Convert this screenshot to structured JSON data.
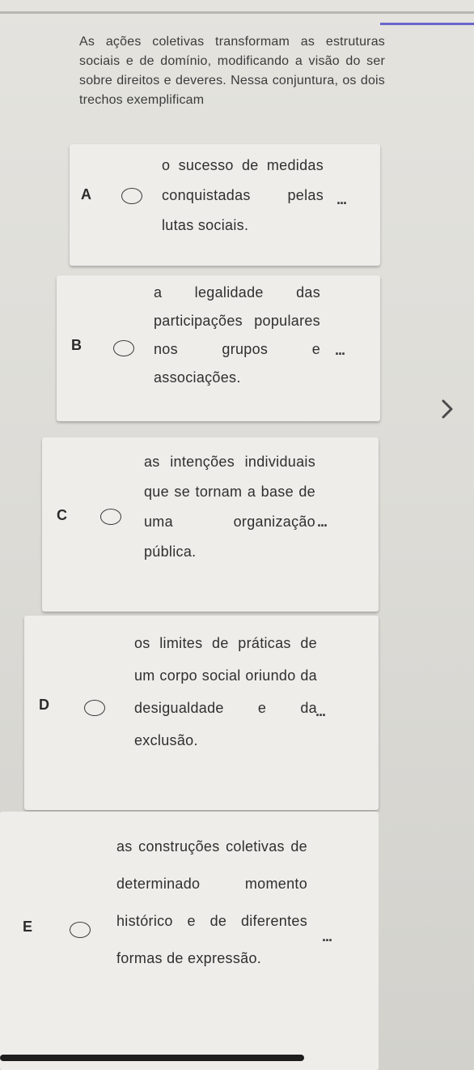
{
  "question": {
    "text": "As ações coletivas transformam as estruturas sociais e de domínio, modificando a visão do ser sobre direitos e deveres. Nessa conjuntura, os dois trechos exemplificam"
  },
  "options": [
    {
      "letter": "A",
      "text": "o sucesso de medidas conquistadas pelas lutas sociais.",
      "more": "..."
    },
    {
      "letter": "B",
      "text": "a legalidade das participações populares nos grupos e associações.",
      "more": "..."
    },
    {
      "letter": "C",
      "text": "as intenções individuais que se tornam a base de uma organização pública.",
      "more": "..."
    },
    {
      "letter": "D",
      "text": "os limites de práticas de um corpo social oriundo da desigualdade e da exclusão.",
      "more": "..."
    },
    {
      "letter": "E",
      "text": "as construções coletivas de determinado momento histórico e de diferentes formas de expressão.",
      "more": "..."
    }
  ],
  "icons": {
    "next": "chevron-right-icon",
    "more": "ellipsis-icon",
    "radio": "radio-unselected-icon"
  },
  "colors": {
    "accent": "#6a66c9",
    "card": "#eeede9",
    "text": "#2f2f2f"
  }
}
